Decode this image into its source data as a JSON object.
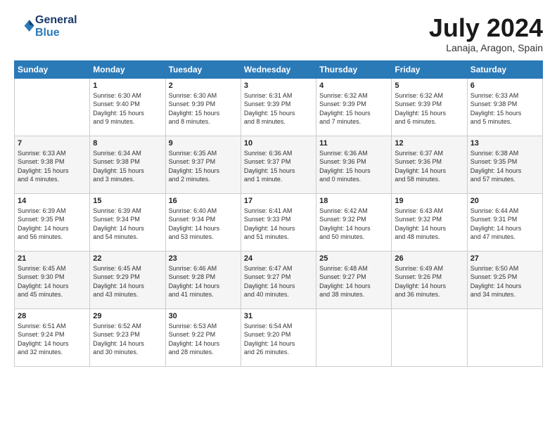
{
  "header": {
    "logo_line1": "General",
    "logo_line2": "Blue",
    "month_title": "July 2024",
    "location": "Lanaja, Aragon, Spain"
  },
  "days_of_week": [
    "Sunday",
    "Monday",
    "Tuesday",
    "Wednesday",
    "Thursday",
    "Friday",
    "Saturday"
  ],
  "weeks": [
    [
      {
        "day": "",
        "content": ""
      },
      {
        "day": "1",
        "content": "Sunrise: 6:30 AM\nSunset: 9:40 PM\nDaylight: 15 hours\nand 9 minutes."
      },
      {
        "day": "2",
        "content": "Sunrise: 6:30 AM\nSunset: 9:39 PM\nDaylight: 15 hours\nand 8 minutes."
      },
      {
        "day": "3",
        "content": "Sunrise: 6:31 AM\nSunset: 9:39 PM\nDaylight: 15 hours\nand 8 minutes."
      },
      {
        "day": "4",
        "content": "Sunrise: 6:32 AM\nSunset: 9:39 PM\nDaylight: 15 hours\nand 7 minutes."
      },
      {
        "day": "5",
        "content": "Sunrise: 6:32 AM\nSunset: 9:39 PM\nDaylight: 15 hours\nand 6 minutes."
      },
      {
        "day": "6",
        "content": "Sunrise: 6:33 AM\nSunset: 9:38 PM\nDaylight: 15 hours\nand 5 minutes."
      }
    ],
    [
      {
        "day": "7",
        "content": "Sunrise: 6:33 AM\nSunset: 9:38 PM\nDaylight: 15 hours\nand 4 minutes."
      },
      {
        "day": "8",
        "content": "Sunrise: 6:34 AM\nSunset: 9:38 PM\nDaylight: 15 hours\nand 3 minutes."
      },
      {
        "day": "9",
        "content": "Sunrise: 6:35 AM\nSunset: 9:37 PM\nDaylight: 15 hours\nand 2 minutes."
      },
      {
        "day": "10",
        "content": "Sunrise: 6:36 AM\nSunset: 9:37 PM\nDaylight: 15 hours\nand 1 minute."
      },
      {
        "day": "11",
        "content": "Sunrise: 6:36 AM\nSunset: 9:36 PM\nDaylight: 15 hours\nand 0 minutes."
      },
      {
        "day": "12",
        "content": "Sunrise: 6:37 AM\nSunset: 9:36 PM\nDaylight: 14 hours\nand 58 minutes."
      },
      {
        "day": "13",
        "content": "Sunrise: 6:38 AM\nSunset: 9:35 PM\nDaylight: 14 hours\nand 57 minutes."
      }
    ],
    [
      {
        "day": "14",
        "content": "Sunrise: 6:39 AM\nSunset: 9:35 PM\nDaylight: 14 hours\nand 56 minutes."
      },
      {
        "day": "15",
        "content": "Sunrise: 6:39 AM\nSunset: 9:34 PM\nDaylight: 14 hours\nand 54 minutes."
      },
      {
        "day": "16",
        "content": "Sunrise: 6:40 AM\nSunset: 9:34 PM\nDaylight: 14 hours\nand 53 minutes."
      },
      {
        "day": "17",
        "content": "Sunrise: 6:41 AM\nSunset: 9:33 PM\nDaylight: 14 hours\nand 51 minutes."
      },
      {
        "day": "18",
        "content": "Sunrise: 6:42 AM\nSunset: 9:32 PM\nDaylight: 14 hours\nand 50 minutes."
      },
      {
        "day": "19",
        "content": "Sunrise: 6:43 AM\nSunset: 9:32 PM\nDaylight: 14 hours\nand 48 minutes."
      },
      {
        "day": "20",
        "content": "Sunrise: 6:44 AM\nSunset: 9:31 PM\nDaylight: 14 hours\nand 47 minutes."
      }
    ],
    [
      {
        "day": "21",
        "content": "Sunrise: 6:45 AM\nSunset: 9:30 PM\nDaylight: 14 hours\nand 45 minutes."
      },
      {
        "day": "22",
        "content": "Sunrise: 6:45 AM\nSunset: 9:29 PM\nDaylight: 14 hours\nand 43 minutes."
      },
      {
        "day": "23",
        "content": "Sunrise: 6:46 AM\nSunset: 9:28 PM\nDaylight: 14 hours\nand 41 minutes."
      },
      {
        "day": "24",
        "content": "Sunrise: 6:47 AM\nSunset: 9:27 PM\nDaylight: 14 hours\nand 40 minutes."
      },
      {
        "day": "25",
        "content": "Sunrise: 6:48 AM\nSunset: 9:27 PM\nDaylight: 14 hours\nand 38 minutes."
      },
      {
        "day": "26",
        "content": "Sunrise: 6:49 AM\nSunset: 9:26 PM\nDaylight: 14 hours\nand 36 minutes."
      },
      {
        "day": "27",
        "content": "Sunrise: 6:50 AM\nSunset: 9:25 PM\nDaylight: 14 hours\nand 34 minutes."
      }
    ],
    [
      {
        "day": "28",
        "content": "Sunrise: 6:51 AM\nSunset: 9:24 PM\nDaylight: 14 hours\nand 32 minutes."
      },
      {
        "day": "29",
        "content": "Sunrise: 6:52 AM\nSunset: 9:23 PM\nDaylight: 14 hours\nand 30 minutes."
      },
      {
        "day": "30",
        "content": "Sunrise: 6:53 AM\nSunset: 9:22 PM\nDaylight: 14 hours\nand 28 minutes."
      },
      {
        "day": "31",
        "content": "Sunrise: 6:54 AM\nSunset: 9:20 PM\nDaylight: 14 hours\nand 26 minutes."
      },
      {
        "day": "",
        "content": ""
      },
      {
        "day": "",
        "content": ""
      },
      {
        "day": "",
        "content": ""
      }
    ]
  ]
}
